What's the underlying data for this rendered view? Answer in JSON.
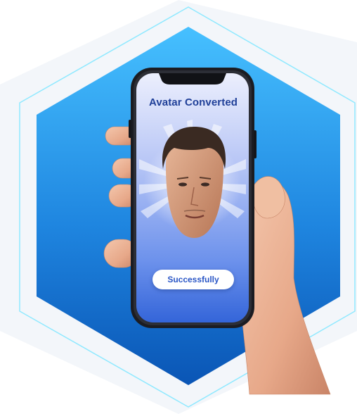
{
  "screen": {
    "title": "Avatar Converted",
    "success_label": "Successfully"
  },
  "icons": {
    "avatar": "avatar-head-icon",
    "phone": "smartphone-icon",
    "hand": "hand-icon"
  },
  "colors": {
    "hexagon_top": "#42b8ff",
    "hexagon_bottom": "#0b57b8",
    "outline": "#7ee6ff",
    "screen_top": "#e8ebff",
    "screen_bottom": "#3c6fe0",
    "title": "#1f3f98",
    "button_text": "#2a56c6"
  }
}
